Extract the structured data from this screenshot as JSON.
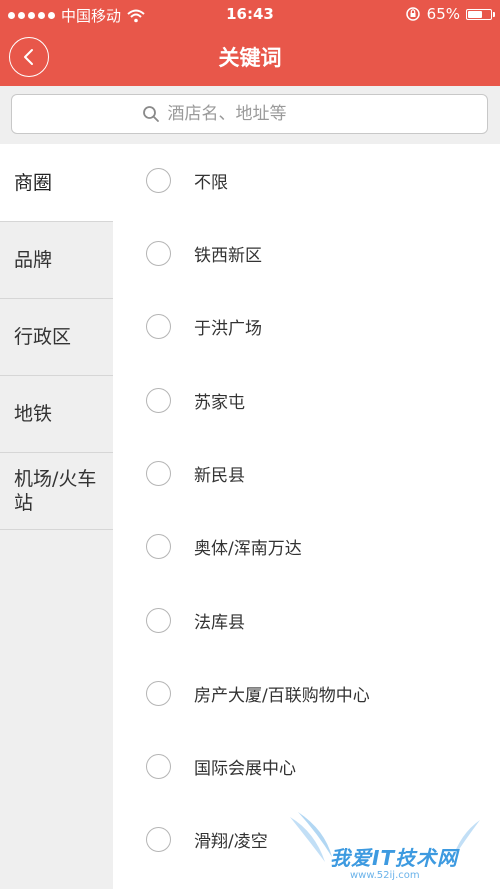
{
  "status_bar": {
    "carrier": "中国移动",
    "time": "16:43",
    "battery": "65%",
    "battery_level": 0.65,
    "icons": [
      "signal-dots-icon",
      "wifi-icon",
      "orientation-lock-icon",
      "battery-icon"
    ]
  },
  "nav": {
    "title": "关键词",
    "back_icon": "chevron-left-icon"
  },
  "search": {
    "placeholder": "酒店名、地址等",
    "value": ""
  },
  "sidebar": {
    "items": [
      {
        "label": "商圈",
        "active": true
      },
      {
        "label": "品牌",
        "active": false
      },
      {
        "label": "行政区",
        "active": false
      },
      {
        "label": "地铁",
        "active": false
      },
      {
        "label": "机场/火车站",
        "active": false
      }
    ]
  },
  "options": {
    "items": [
      {
        "label": "不限",
        "selected": false
      },
      {
        "label": "铁西新区",
        "selected": false
      },
      {
        "label": "于洪广场",
        "selected": false
      },
      {
        "label": "苏家屯",
        "selected": false
      },
      {
        "label": "新民县",
        "selected": false
      },
      {
        "label": "奥体/浑南万达",
        "selected": false
      },
      {
        "label": "法库县",
        "selected": false
      },
      {
        "label": "房产大厦/百联购物中心",
        "selected": false
      },
      {
        "label": "国际会展中心",
        "selected": false
      },
      {
        "label": "滑翔/凌空",
        "selected": false
      }
    ]
  },
  "watermark": {
    "text": "我爱IT技术网",
    "sub": "www.52ij.com"
  },
  "colors": {
    "accent": "#e8574a",
    "sidebar_bg": "#efefef",
    "watermark": "#3d9ae0"
  }
}
